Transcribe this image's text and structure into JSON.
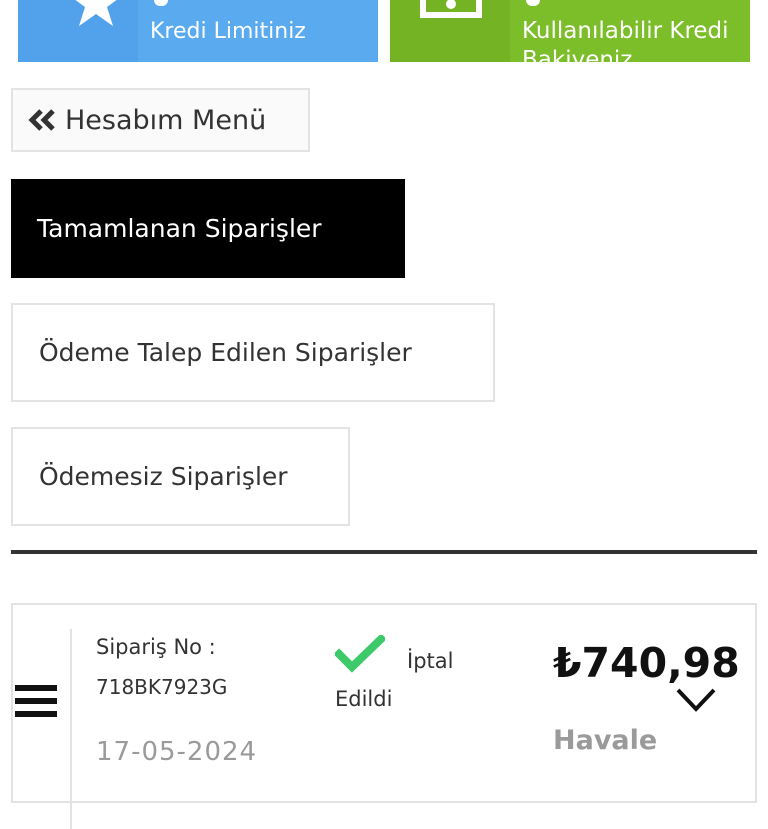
{
  "summary_cards": [
    {
      "label": "Kredi Limitiniz",
      "icon": "star-icon",
      "color": "#5aaaf0"
    },
    {
      "label": "Kullanılabilir Kredi Bakiyeniz",
      "icon": "money-icon",
      "color": "#7cbd2a"
    }
  ],
  "menu": {
    "toggle_label": "Hesabım Menü",
    "toggle_icon": "double-chevron-left-icon"
  },
  "tabs": [
    {
      "label": "Tamamlanan Siparişler",
      "active": true
    },
    {
      "label": "Ödeme Talep Edilen Siparişler",
      "active": false
    },
    {
      "label": "Ödemesiz Siparişler",
      "active": false
    }
  ],
  "order": {
    "order_no_label": "Sipariş No :",
    "order_no": "718BK7923G",
    "date": "17-05-2024",
    "status_line1": "İptal",
    "status_line2": "Edildi",
    "status_icon": "check-icon",
    "status_icon_color": "#3ec96a",
    "amount": "₺740,98",
    "payment_method": "Havale",
    "expand_icon": "chevron-down-icon",
    "row_icon": "hamburger-menu-icon"
  }
}
